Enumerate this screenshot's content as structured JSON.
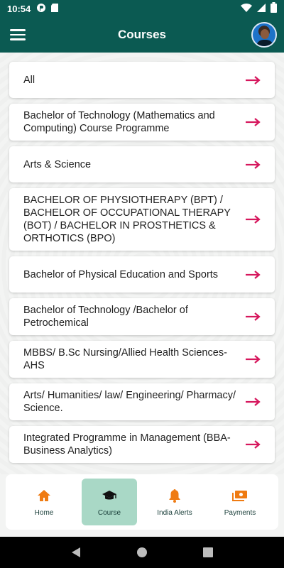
{
  "status_bar": {
    "time": "10:54"
  },
  "app_bar": {
    "title": "Courses"
  },
  "courses": [
    {
      "label": "All"
    },
    {
      "label": "Bachelor of Technology (Mathematics and Computing) Course Programme"
    },
    {
      "label": "Arts & Science"
    },
    {
      "label": "BACHELOR OF PHYSIOTHERAPY (BPT) / BACHELOR OF OCCUPATIONAL THERAPY (BOT) / BACHELOR IN PROSTHETICS & ORTHOTICS (BPO)"
    },
    {
      "label": "Bachelor of Physical Education and Sports"
    },
    {
      "label": "Bachelor of Technology /Bachelor of Petrochemical"
    },
    {
      "label": "MBBS/ B.Sc Nursing/Allied Health Sciences-AHS"
    },
    {
      "label": "Arts/ Humanities/ law/ Engineering/ Pharmacy/ Science."
    },
    {
      "label": "Integrated Programme in Management (BBA-Business Analytics)"
    }
  ],
  "bottom_nav": {
    "items": [
      {
        "label": "Home",
        "icon": "home-icon"
      },
      {
        "label": "Course",
        "icon": "graduation-cap-icon"
      },
      {
        "label": "India Alerts",
        "icon": "bell-icon"
      },
      {
        "label": "Payments",
        "icon": "payments-icon"
      }
    ],
    "active": "Course"
  },
  "colors": {
    "primary": "#0b5a52",
    "arrow": "#d6175d",
    "nav_active_bg": "#a9d8c6",
    "nav_icon": "#ef7b12"
  }
}
